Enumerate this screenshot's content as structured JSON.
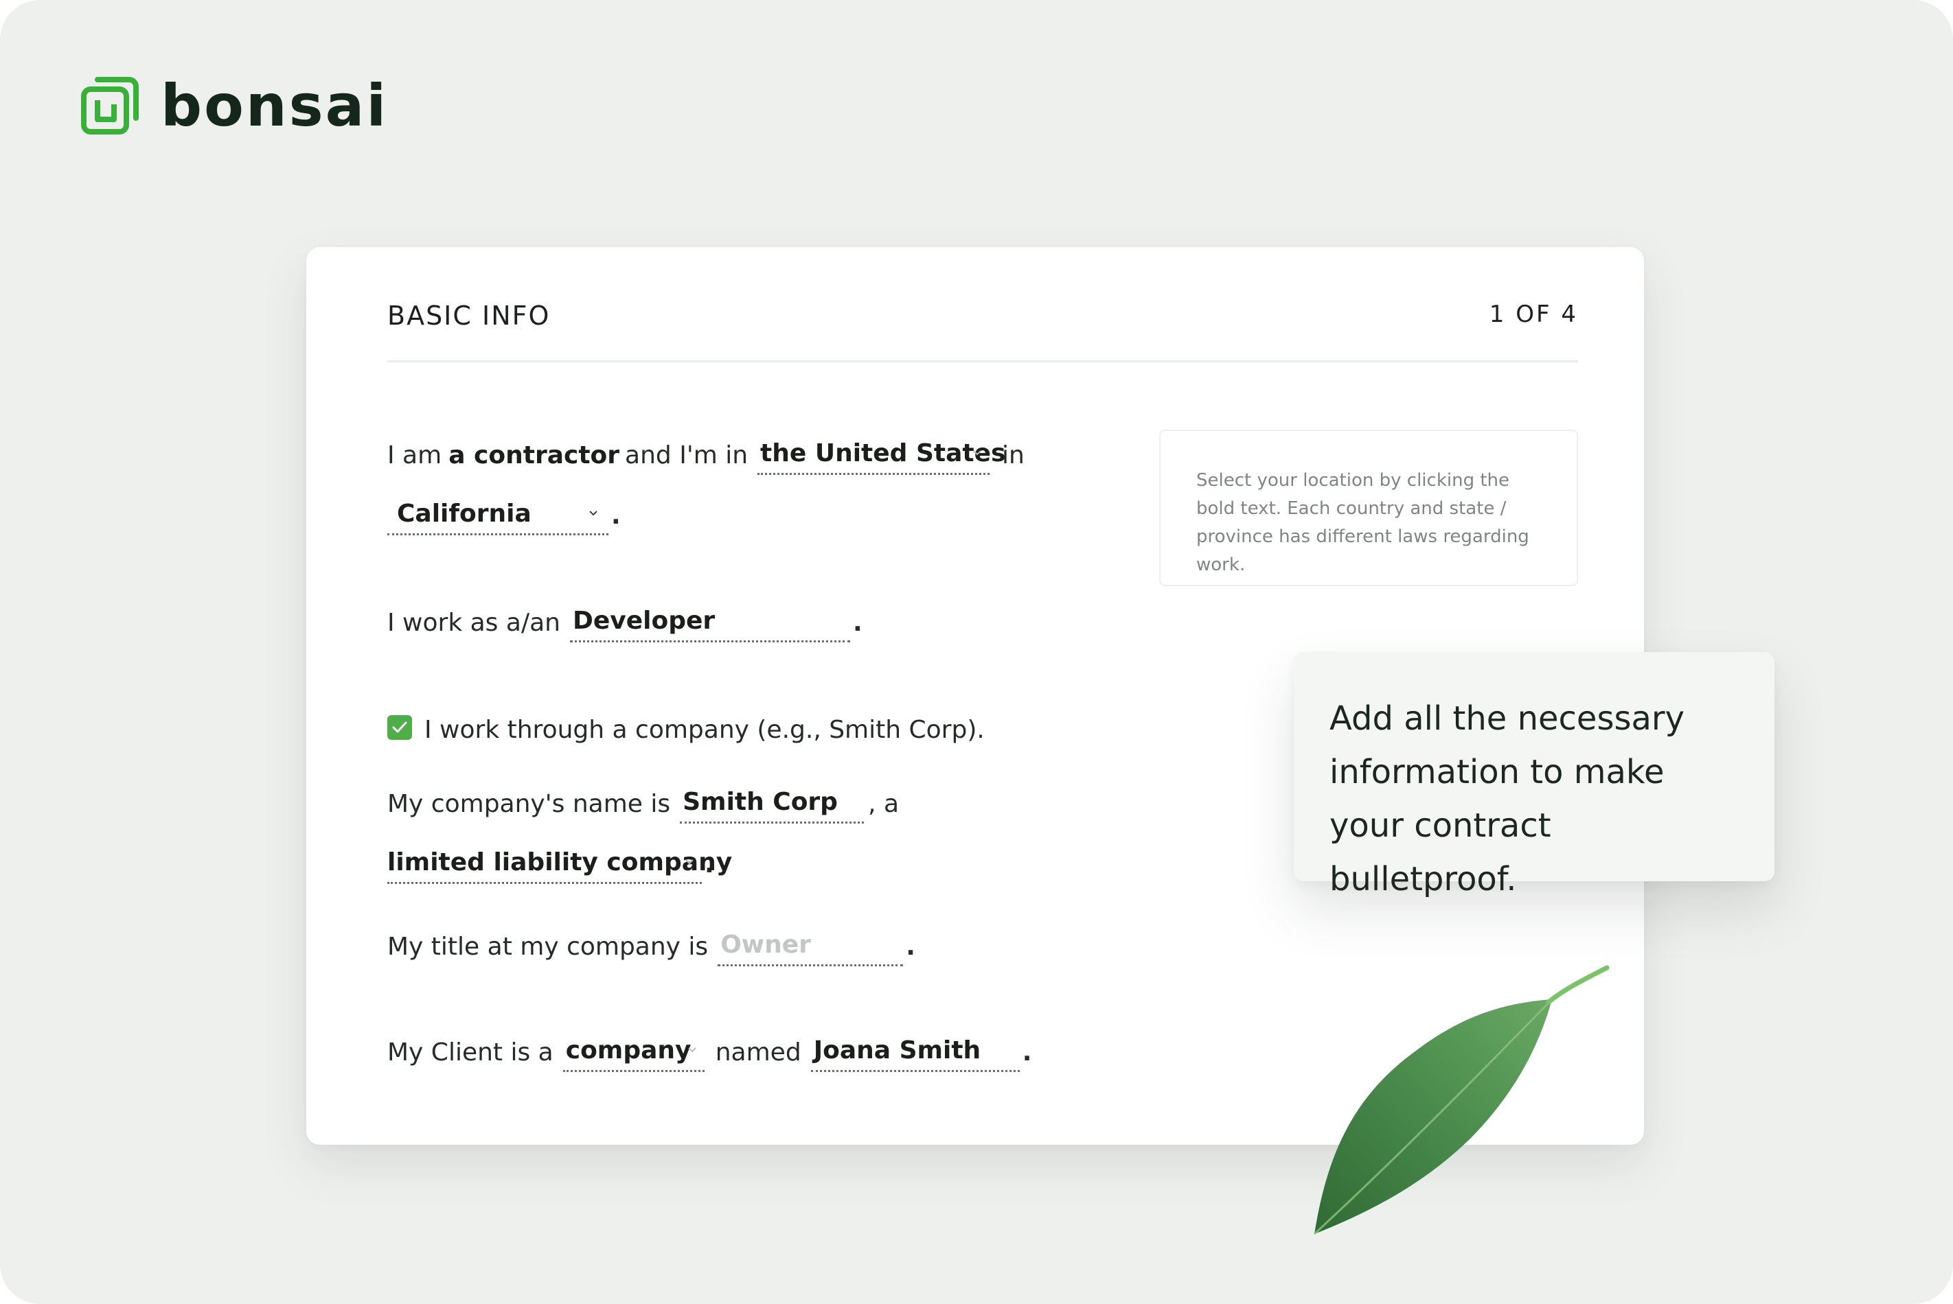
{
  "brand": {
    "name": "bonsai",
    "accent": "#38b03a"
  },
  "card": {
    "title": "BASIC INFO",
    "step": "1 OF 4"
  },
  "form": {
    "line1": {
      "prefix": "I am",
      "role": "a contractor",
      "mid": "and I'm in",
      "country": "the United States",
      "suffix": "in"
    },
    "line2": {
      "state": "California",
      "end": "."
    },
    "line3": {
      "prefix": "I work as a/an",
      "occupation": "Developer",
      "end": "."
    },
    "line4": {
      "checkbox_checked": true,
      "label": "I work through a company (e.g., Smith Corp)."
    },
    "line5": {
      "prefix": "My company's name is",
      "company_name": "Smith Corp",
      "suffix": ", a"
    },
    "line6": {
      "company_type": "limited liability company",
      "end": "."
    },
    "line7": {
      "prefix": "My title at my company is",
      "title_placeholder": "Owner",
      "end": "."
    },
    "line8": {
      "prefix": "My Client is a",
      "client_type": "company",
      "mid": "named",
      "client_name": "Joana Smith",
      "end": "."
    }
  },
  "hint": "Select your location by clicking the bold text. Each country and state / province has different laws regarding work.",
  "callout": "Add all the necessary information to make your contract bulletproof.",
  "icons": [
    "bonsai-logo-icon",
    "chevron-down-icon",
    "checkmark-icon",
    "leaf-illustration"
  ]
}
